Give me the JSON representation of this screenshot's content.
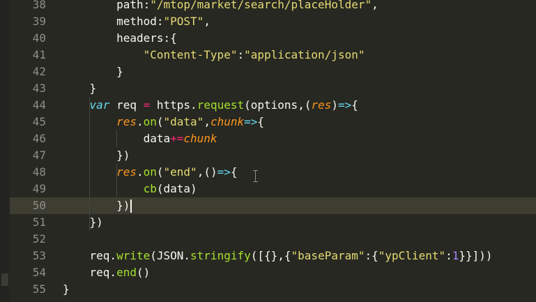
{
  "editor": {
    "theme_colors": {
      "background": "#272822",
      "current_line": "#3e3d32",
      "keyword": "#66d9ef",
      "string": "#e6db74",
      "operator": "#f92672",
      "function": "#a6e22e",
      "parameter": "#fd971f",
      "number": "#ae81ff",
      "line_number": "#8f908a"
    },
    "current_line_number": "50",
    "lines": [
      {
        "num": "38",
        "tokens": [
          {
            "t": "        path:"
          },
          {
            "t": "\"/mtop/market/search/placeHolder\"",
            "c": "str"
          },
          {
            "t": ","
          }
        ]
      },
      {
        "num": "39",
        "tokens": [
          {
            "t": "        method:"
          },
          {
            "t": "\"POST\"",
            "c": "str"
          },
          {
            "t": ","
          }
        ]
      },
      {
        "num": "40",
        "tokens": [
          {
            "t": "        headers:{"
          }
        ]
      },
      {
        "num": "41",
        "tokens": [
          {
            "t": "            "
          },
          {
            "t": "\"Content-Type\"",
            "c": "str"
          },
          {
            "t": ":"
          },
          {
            "t": "\"application/json\"",
            "c": "str"
          }
        ]
      },
      {
        "num": "42",
        "tokens": [
          {
            "t": "        }"
          }
        ]
      },
      {
        "num": "43",
        "tokens": [
          {
            "t": "    }"
          }
        ]
      },
      {
        "num": "44",
        "tokens": [
          {
            "t": "    "
          },
          {
            "t": "var",
            "c": "kw"
          },
          {
            "t": " req "
          },
          {
            "t": "=",
            "c": "op"
          },
          {
            "t": " https."
          },
          {
            "t": "request",
            "c": "fn"
          },
          {
            "t": "(options,("
          },
          {
            "t": "res",
            "c": "param"
          },
          {
            "t": ")"
          },
          {
            "t": "=>",
            "c": "kw"
          },
          {
            "t": "{"
          }
        ]
      },
      {
        "num": "45",
        "tokens": [
          {
            "t": "        "
          },
          {
            "t": "res",
            "c": "param"
          },
          {
            "t": "."
          },
          {
            "t": "on",
            "c": "fn"
          },
          {
            "t": "("
          },
          {
            "t": "\"data\"",
            "c": "str"
          },
          {
            "t": ","
          },
          {
            "t": "chunk",
            "c": "param"
          },
          {
            "t": "=>",
            "c": "kw"
          },
          {
            "t": "{"
          }
        ]
      },
      {
        "num": "46",
        "tokens": [
          {
            "t": "            data"
          },
          {
            "t": "+=",
            "c": "op"
          },
          {
            "t": "chunk",
            "c": "param"
          }
        ]
      },
      {
        "num": "47",
        "tokens": [
          {
            "t": "        })"
          }
        ]
      },
      {
        "num": "48",
        "tokens": [
          {
            "t": "        "
          },
          {
            "t": "res",
            "c": "param"
          },
          {
            "t": "."
          },
          {
            "t": "on",
            "c": "fn"
          },
          {
            "t": "("
          },
          {
            "t": "\"end\"",
            "c": "str"
          },
          {
            "t": ",()"
          },
          {
            "t": "=>",
            "c": "kw"
          },
          {
            "t": "{"
          }
        ]
      },
      {
        "num": "49",
        "tokens": [
          {
            "t": "            "
          },
          {
            "t": "cb",
            "c": "fn"
          },
          {
            "t": "(data)"
          }
        ]
      },
      {
        "num": "50",
        "tokens": [
          {
            "t": "        })"
          }
        ]
      },
      {
        "num": "51",
        "tokens": [
          {
            "t": "    })"
          }
        ]
      },
      {
        "num": "52",
        "tokens": [
          {
            "t": ""
          }
        ]
      },
      {
        "num": "53",
        "tokens": [
          {
            "t": "    req."
          },
          {
            "t": "write",
            "c": "fn"
          },
          {
            "t": "(JSON."
          },
          {
            "t": "stringify",
            "c": "fn"
          },
          {
            "t": "([{},{"
          },
          {
            "t": "\"baseParam\"",
            "c": "str"
          },
          {
            "t": ":{"
          },
          {
            "t": "\"ypClient\"",
            "c": "str"
          },
          {
            "t": ":"
          },
          {
            "t": "1",
            "c": "num"
          },
          {
            "t": "}}]))"
          }
        ]
      },
      {
        "num": "54",
        "tokens": [
          {
            "t": "    req."
          },
          {
            "t": "end",
            "c": "fn"
          },
          {
            "t": "()"
          }
        ]
      },
      {
        "num": "55",
        "tokens": [
          {
            "t": "}"
          }
        ]
      }
    ]
  }
}
